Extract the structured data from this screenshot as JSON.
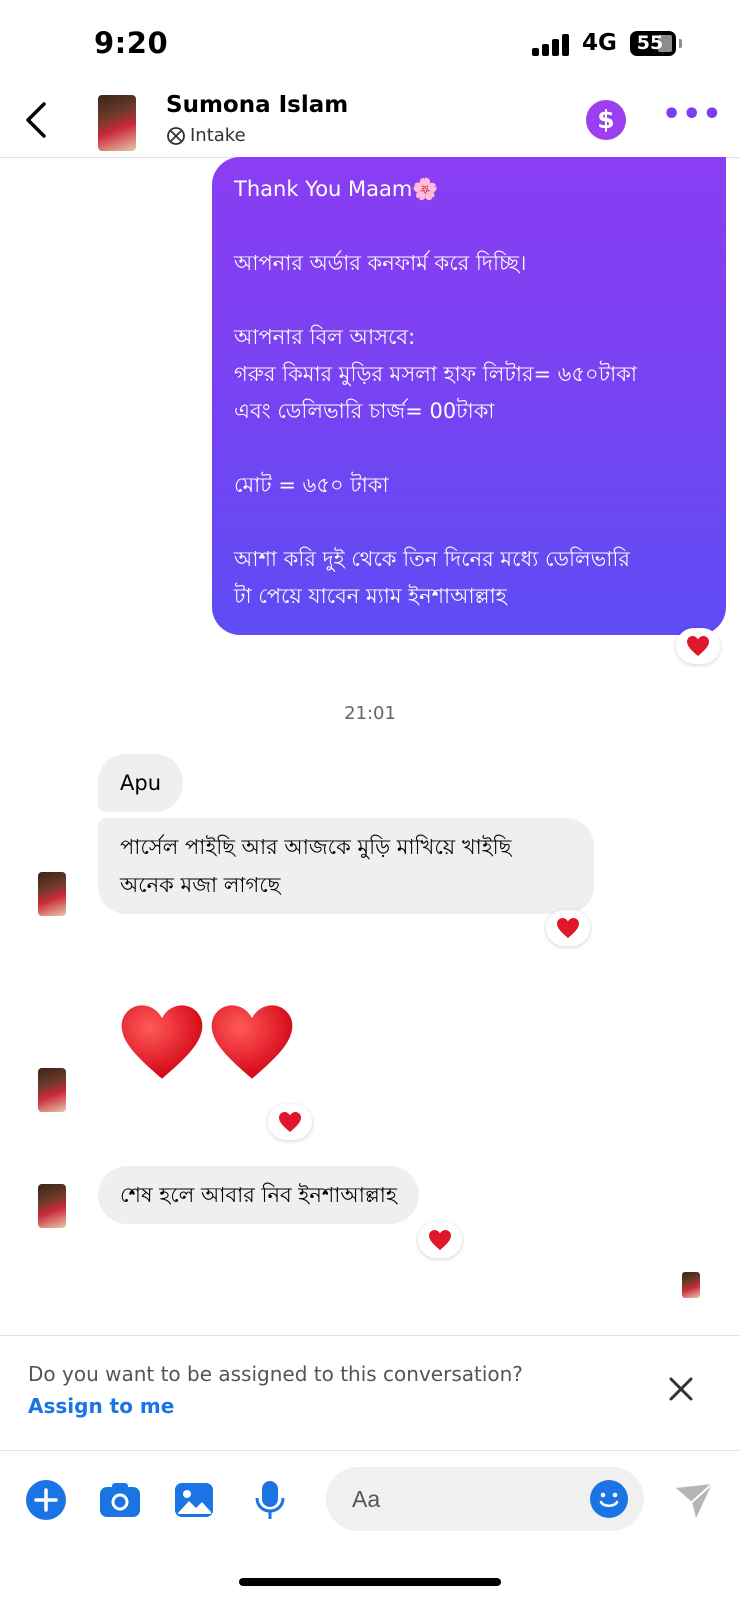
{
  "status_bar": {
    "time": "9:20",
    "network": "4G",
    "battery": "55"
  },
  "header": {
    "name": "Sumona Islam",
    "subtitle": "Intake"
  },
  "outgoing_message": {
    "lines": [
      "Thank You Maam🌸",
      "",
      "আপনার অর্ডার কনফার্ম করে দিচ্ছি।",
      "",
      "আপনার বিল আসবে:",
      "গরুর কিমার মুড়ির মসলা হাফ লিটার= ৬৫০টাকা",
      "এবং ডেলিভারি চার্জ= 00টাকা",
      "",
      "মোট = ৬৫০ টাকা",
      "",
      "আশা করি দুই থেকে তিন দিনের মধ্যে ডেলিভারি",
      "টা পেয়ে যাবেন ম্যাম ইনশাআল্লাহ"
    ]
  },
  "timestamp": "21:01",
  "incoming_messages": {
    "apu": "Apu",
    "parcel": "পার্সেল পাইছি আর আজকে মুড়ি মাখিয়ে খাইছি\nঅনেক মজা লাগছে",
    "again": "শেষ হলে আবার নিব ইনশাআল্লাহ"
  },
  "assign_banner": {
    "question": "Do you want to be assigned to this conversation?",
    "action": "Assign to me"
  },
  "composer": {
    "placeholder": "Aa"
  },
  "colors": {
    "accent": "#1b74e4",
    "bubble_top": "#8a3df2",
    "bubble_bottom": "#5e4cf4",
    "heart": "#e0162b"
  }
}
